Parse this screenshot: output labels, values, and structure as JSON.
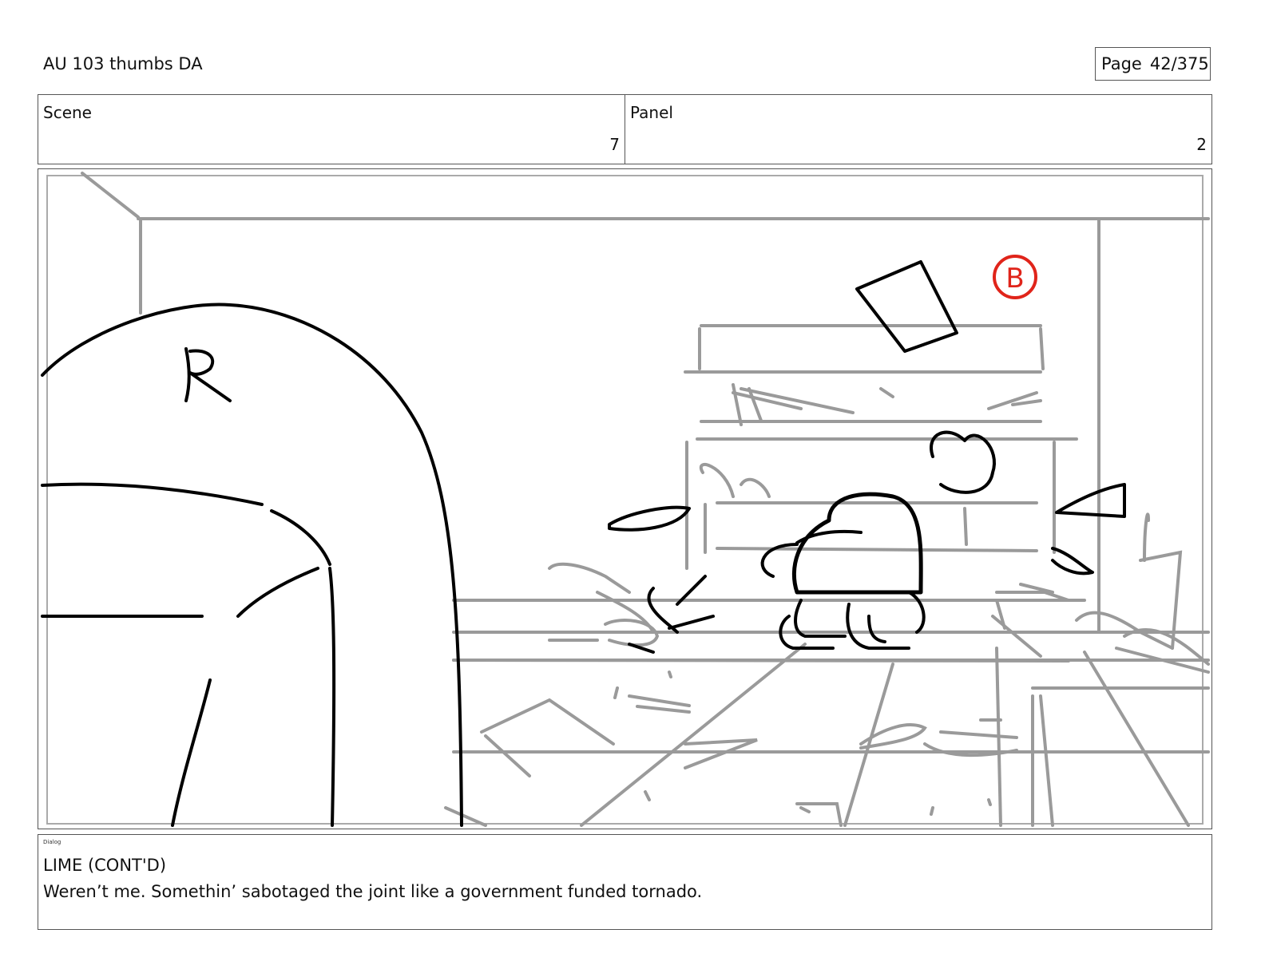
{
  "header": {
    "doc_title": "AU 103 thumbs DA",
    "page_label": "Page",
    "page_number": "42/375"
  },
  "info": {
    "scene_label": "Scene",
    "scene_value": "7",
    "panel_label": "Panel",
    "panel_value": "2"
  },
  "sketch": {
    "foreground_mark": "R",
    "background_mark": "B",
    "background_mark_color": "#e0241a"
  },
  "dialog": {
    "label": "Dialog",
    "speaker": "LIME (CONT'D)",
    "line": "Weren’t me. Somethin’ sabotaged the joint like a government funded tornado."
  }
}
